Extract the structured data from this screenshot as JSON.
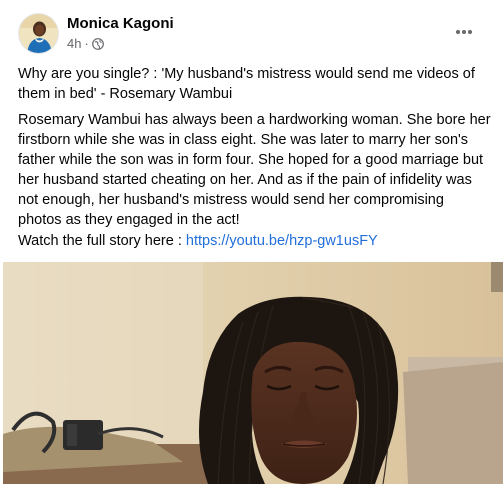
{
  "post": {
    "author": "Monica Kagoni",
    "time": "4h",
    "privacy_icon": "globe-icon",
    "title": "Why are you single? : 'My husband's mistress would send me videos of them in bed' - Rosemary Wambui",
    "body": "Rosemary Wambui has always been a hardworking woman. She bore her firstborn while she was in class eight. She was later to marry her son's father while the son was in form four. She hoped for a good marriage but her husband started cheating on her. And as if the pain of infidelity was not enough, her husband's mistress would send her compromising  photos as they engaged in the act!",
    "watch_label": "Watch the full story here : ",
    "link_text": "https://youtu.be/hzp-gw1usFY"
  },
  "colors": {
    "link": "#216fdb",
    "meta": "#65676b"
  }
}
